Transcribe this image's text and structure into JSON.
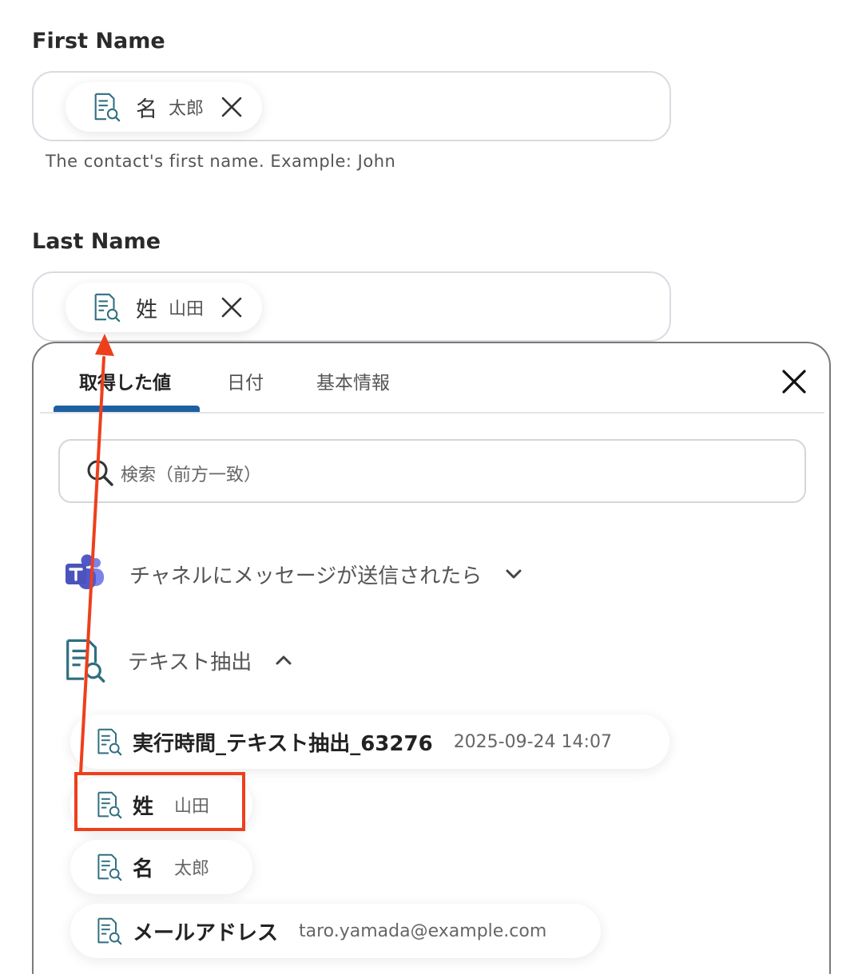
{
  "first_name": {
    "label": "First Name",
    "chip_key": "名",
    "chip_value": "太郎",
    "hint": "The contact's first name. Example: John"
  },
  "last_name": {
    "label": "Last Name",
    "chip_key": "姓",
    "chip_value": "山田"
  },
  "panel": {
    "tabs": [
      {
        "label": "取得した値",
        "active": true
      },
      {
        "label": "日付",
        "active": false
      },
      {
        "label": "基本情報",
        "active": false
      }
    ],
    "search_placeholder": "検索（前方一致）",
    "groups": [
      {
        "label": "チャネルにメッセージが送信されたら",
        "icon": "teams-icon",
        "expanded": false
      },
      {
        "label": "テキスト抽出",
        "icon": "document-search-icon",
        "expanded": true
      }
    ],
    "items": [
      {
        "key": "実行時間_テキスト抽出_63276",
        "value": "2025-09-24 14:07"
      },
      {
        "key": "姓",
        "value": "山田"
      },
      {
        "key": "名",
        "value": "太郎"
      },
      {
        "key": "メールアドレス",
        "value": "taro.yamada@example.com"
      }
    ]
  },
  "colors": {
    "accent": "#1d5fa0",
    "highlight": "#ee3f1c",
    "icon_teal": "#2f6f80",
    "teams_purple": "#5059c9"
  }
}
